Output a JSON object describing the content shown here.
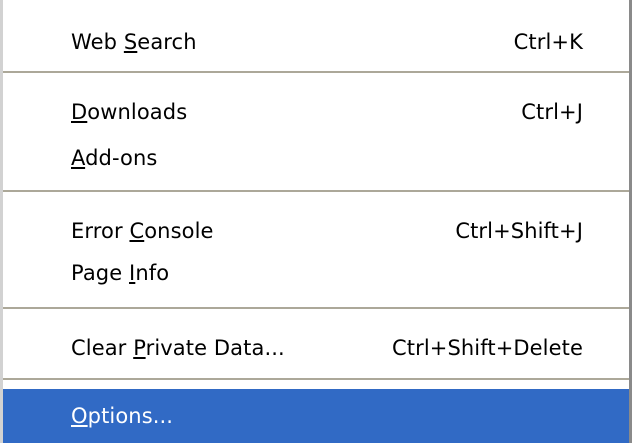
{
  "menu": {
    "items": [
      {
        "label": "Web Search",
        "mnemonic_before": "Web ",
        "mnemonic": "S",
        "mnemonic_after": "earch",
        "shortcut": "Ctrl+K"
      },
      {
        "label": "Downloads",
        "mnemonic_before": "",
        "mnemonic": "D",
        "mnemonic_after": "ownloads",
        "shortcut": "Ctrl+J"
      },
      {
        "label": "Add-ons",
        "mnemonic_before": "",
        "mnemonic": "A",
        "mnemonic_after": "dd-ons",
        "shortcut": ""
      },
      {
        "label": "Error Console",
        "mnemonic_before": "Error ",
        "mnemonic": "C",
        "mnemonic_after": "onsole",
        "shortcut": "Ctrl+Shift+J"
      },
      {
        "label": "Page Info",
        "mnemonic_before": "Page ",
        "mnemonic": "I",
        "mnemonic_after": "nfo",
        "shortcut": ""
      },
      {
        "label": "Clear Private Data...",
        "mnemonic_before": "Clear ",
        "mnemonic": "P",
        "mnemonic_after": "rivate Data...",
        "shortcut": "Ctrl+Shift+Delete"
      },
      {
        "label": "Options...",
        "mnemonic_before": "",
        "mnemonic": "O",
        "mnemonic_after": "ptions...",
        "shortcut": ""
      }
    ],
    "selected_item": "Options..."
  },
  "colors": {
    "selection_bg": "#316ac5",
    "selection_text": "#ffffff",
    "separator": "#aca899"
  }
}
